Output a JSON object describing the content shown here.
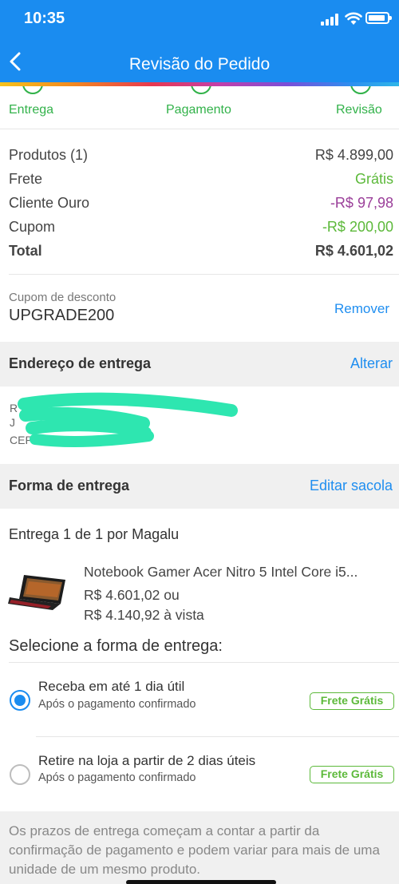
{
  "status_bar": {
    "time": "10:35"
  },
  "nav": {
    "title": "Revisão do Pedido"
  },
  "steps": [
    {
      "label": "Entrega"
    },
    {
      "label": "Pagamento"
    },
    {
      "label": "Revisão"
    }
  ],
  "summary": {
    "products_label": "Produtos (1)",
    "products_value": "R$ 4.899,00",
    "shipping_label": "Frete",
    "shipping_value": "Grátis",
    "gold_label": "Cliente Ouro",
    "gold_value": "-R$ 97,98",
    "coupon_label": "Cupom",
    "coupon_value": "-R$ 200,00",
    "total_label": "Total",
    "total_value": "R$ 4.601,02"
  },
  "coupon": {
    "label": "Cupom de desconto",
    "code": "UPGRADE200",
    "remove": "Remover"
  },
  "address": {
    "title": "Endereço de entrega",
    "action": "Alterar"
  },
  "delivery": {
    "title": "Forma de entrega",
    "action": "Editar sacola",
    "shipment": "Entrega 1 de 1 por Magalu",
    "product_name": "Notebook Gamer Acer Nitro 5 Intel Core i5...",
    "price_installments": "R$ 4.601,02 ou",
    "price_cash": "R$ 4.140,92 à vista",
    "select_title": "Selecione a forma de entrega:",
    "options": [
      {
        "title": "Receba em até 1 dia útil",
        "subtitle": "Após o pagamento confirmado",
        "badge": "Frete Grátis",
        "selected": true
      },
      {
        "title": "Retire na loja a partir de 2 dias úteis",
        "subtitle": "Após o pagamento confirmado",
        "badge": "Frete Grátis",
        "selected": false
      }
    ]
  },
  "footer_note": "Os prazos de entrega começam a contar a partir da confirmação de pagamento e podem variar para mais de uma unidade de um mesmo produto.",
  "colors": {
    "primary": "#1a8cf0",
    "green": "#5cb93a",
    "purple": "#9a3e99",
    "redaction": "#2ee6b0"
  },
  "icons": [
    "signal-icon",
    "wifi-icon",
    "battery-icon",
    "back-arrow-icon",
    "radio-selected-icon",
    "radio-unselected-icon",
    "laptop-thumbnail"
  ]
}
